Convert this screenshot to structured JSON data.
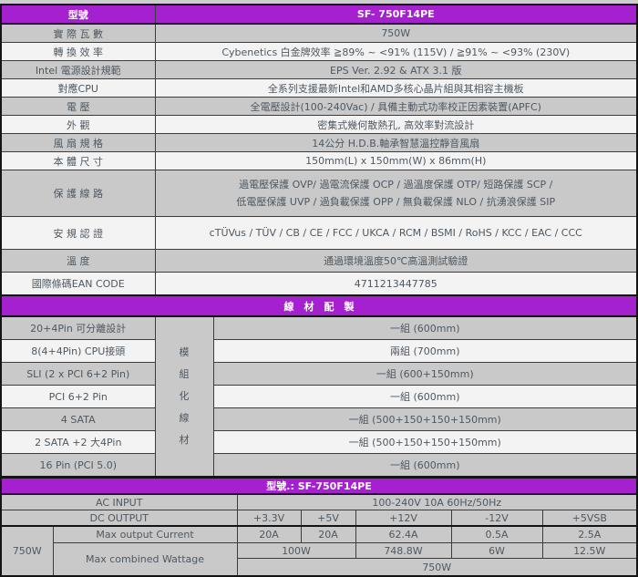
{
  "colors": {
    "accent_purple": "#a520ce",
    "row_gray": "#c9c9c9",
    "row_white": "#f3f3f3",
    "border": "#141414",
    "text": "#4f5860",
    "header_text": "#ffffff"
  },
  "spec_table": {
    "header": {
      "label": "型號",
      "value": "SF- 750F14PE"
    },
    "rows": [
      {
        "label": "實 際 瓦 數",
        "value": "750W"
      },
      {
        "label": "轉 換 效 率",
        "value": "Cybenetics 白金牌效率 ≧89% ~ <91% (115V) / ≧91% ~ <93% (230V)"
      },
      {
        "label": "Intel 電源設計規範",
        "value": "EPS Ver. 2.92 & ATX 3.1 版"
      },
      {
        "label": "對應CPU",
        "value": "全系列支援最新Intel和AMD多核心晶片組與其相容主機板"
      },
      {
        "label": "電 壓",
        "value": "全電壓設計(100-240Vac) / 具備主動式功率校正因素裝置(APFC)"
      },
      {
        "label": "外 觀",
        "value": "密集式幾何散熱孔, 高效率對流設計"
      },
      {
        "label": "風 扇 規 格",
        "value": "14公分 H.D.B.軸承智慧溫控靜音風扇"
      },
      {
        "label": "本 體 尺 寸",
        "value": "150mm(L) x 150mm(W) x 86mm(H)"
      },
      {
        "label": "保 護 線 路",
        "value": "過電壓保護 OVP/ 過電流保護 OCP / 過溫度保護 OTP/ 短路保護 SCP /\n低電壓保護 UVP / 過負載保護 OPP / 無負載保護 NLO / 抗湧浪保護 SIP"
      },
      {
        "label": "安 規 認 證",
        "value": "cTÜVus / TÜV / CB / CE / FCC / UKCA / RCM / BSMI / RoHS / KCC / EAC / CCC"
      },
      {
        "label": "溫 度",
        "value": "通過環境溫度50℃高溫測試驗證"
      },
      {
        "label": "國際條碼EAN CODE",
        "value": "4711213447785"
      }
    ]
  },
  "cable_section": {
    "title": "線　材　配　製",
    "modular_label": "模組化線材",
    "rows": [
      {
        "label": "20+4Pin 可分離設計",
        "value": "一組 (600mm)"
      },
      {
        "label": "8(4+4Pin) CPU接頭",
        "value": "兩組 (700mm)"
      },
      {
        "label": "SLI (2 x PCI 6+2 Pin)",
        "value": "一組 (600+150mm)"
      },
      {
        "label": "PCI 6+2 Pin",
        "value": "一組 (600mm)"
      },
      {
        "label": "4 SATA",
        "value": "一組 (500+150+150+150mm)"
      },
      {
        "label": "2 SATA +2 大4Pin",
        "value": "一組 (500+150+150+150mm)"
      },
      {
        "label": "16 Pin (PCI 5.0)",
        "value": "一組 (600mm)"
      }
    ]
  },
  "output_table": {
    "title": "型號.: SF-750F14PE",
    "ac_input_label": "AC INPUT",
    "ac_input_value": "100-240V 10A 60Hz/50Hz",
    "dc_output_label": "DC OUTPUT",
    "rails": [
      "+3.3V",
      "+5V",
      "+12V",
      "-12V",
      "+5VSB"
    ],
    "total_wattage": "750W",
    "max_current_label": "Max output Current",
    "max_current": [
      "20A",
      "20A",
      "62.4A",
      "0.5A",
      "2.5A"
    ],
    "max_wattage_label": "Max combined Wattage",
    "combined_wattage": [
      "100W",
      "748.8W",
      "6W",
      "12.5W"
    ],
    "combined_total": "750W"
  }
}
